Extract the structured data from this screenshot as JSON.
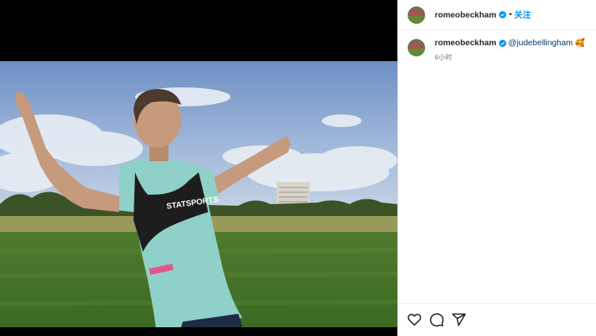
{
  "post": {
    "username": "romeobeckham",
    "follow_label": "关注",
    "separator": "•",
    "caption": {
      "username": "romeobeckham",
      "mention": "@judebellingham",
      "emoji": "🥰",
      "timestamp": "6小时"
    },
    "image": {
      "description_icon": "photo-of-player-arms-outstretched",
      "bib_text": "STATSPORTS"
    }
  },
  "icons": {
    "like": "heart-icon",
    "comment": "comment-icon",
    "share": "send-icon",
    "verified": "verified-badge-icon"
  },
  "colors": {
    "link": "#0095f6",
    "mention": "#00376b",
    "verified": "#0095f6",
    "muted": "#737373"
  }
}
